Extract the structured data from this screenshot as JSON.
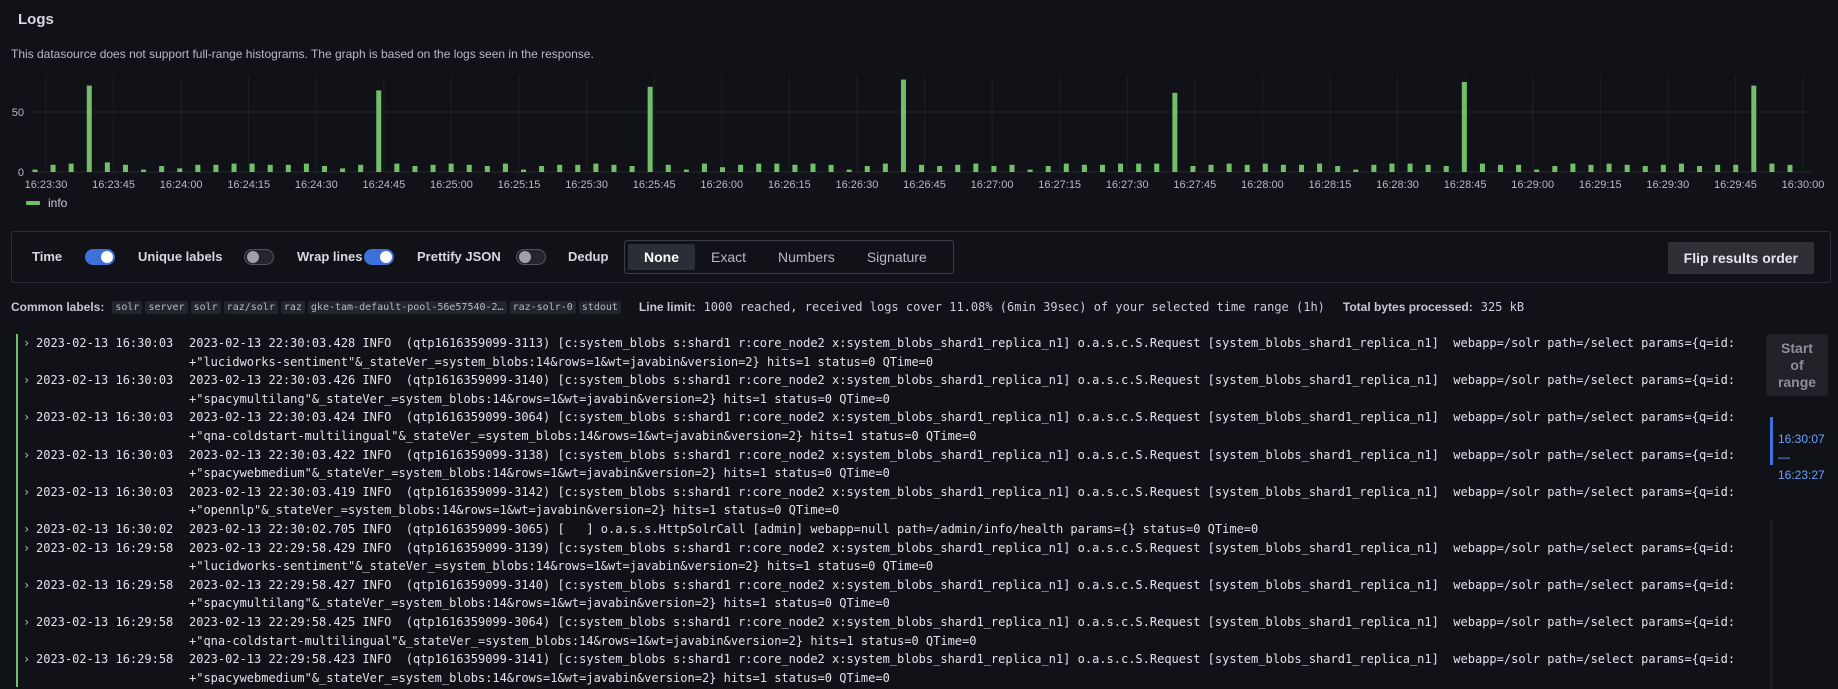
{
  "panel": {
    "title": "Logs",
    "notice": "This datasource does not support full-range histograms. The graph is based on the logs seen in the response."
  },
  "chart_data": {
    "type": "bar",
    "y_ticks": [
      0,
      50
    ],
    "ylim": [
      0,
      80
    ],
    "x_tick_labels": [
      "16:23:30",
      "16:23:45",
      "16:24:00",
      "16:24:15",
      "16:24:30",
      "16:24:45",
      "16:25:00",
      "16:25:15",
      "16:25:30",
      "16:25:45",
      "16:26:00",
      "16:26:15",
      "16:26:30",
      "16:26:45",
      "16:27:00",
      "16:27:15",
      "16:27:30",
      "16:27:45",
      "16:28:00",
      "16:28:15",
      "16:28:30",
      "16:28:45",
      "16:29:00",
      "16:29:15",
      "16:29:30",
      "16:29:45",
      "16:30:00"
    ],
    "grid": true,
    "series": [
      {
        "name": "info",
        "color": "#73bf69",
        "values": [
          2,
          6,
          7,
          72,
          8,
          6,
          2,
          5,
          3,
          6,
          6,
          7,
          7,
          6,
          6,
          7,
          5,
          3,
          6,
          68,
          7,
          5,
          6,
          7,
          6,
          5,
          7,
          2,
          5,
          6,
          6,
          7,
          6,
          5,
          71,
          6,
          2,
          7,
          4,
          6,
          7,
          7,
          6,
          7,
          6,
          2,
          5,
          7,
          77,
          6,
          5,
          6,
          7,
          5,
          6,
          2,
          5,
          7,
          6,
          6,
          7,
          7,
          7,
          66,
          5,
          6,
          7,
          6,
          7,
          6,
          6,
          7,
          5,
          2,
          6,
          7,
          7,
          6,
          5,
          75,
          7,
          6,
          6,
          2,
          5,
          7,
          6,
          7,
          6,
          5,
          6,
          7,
          5,
          6,
          6,
          72,
          7,
          6
        ]
      }
    ],
    "legend": "bottom-left"
  },
  "options": {
    "time": {
      "label": "Time",
      "on": true
    },
    "unique_labels": {
      "label": "Unique labels",
      "on": false
    },
    "wrap_lines": {
      "label": "Wrap lines",
      "on": true
    },
    "prettify_json": {
      "label": "Prettify JSON",
      "on": false
    },
    "dedup": {
      "label": "Dedup",
      "options": [
        "None",
        "Exact",
        "Numbers",
        "Signature"
      ],
      "selected": "None"
    },
    "flip_label": "Flip results order"
  },
  "meta": {
    "common_labels_label": "Common labels:",
    "common_labels": [
      "solr",
      "server",
      "solr",
      "raz/solr",
      "raz",
      "gke-tam-default-pool-56e57540-2…",
      "raz-solr-0",
      "stdout"
    ],
    "line_limit_label": "Line limit:",
    "line_limit_value": "1000 reached, received logs cover 11.08% (6min 39sec) of your selected time range (1h)",
    "bytes_label": "Total bytes processed:",
    "bytes_value": "325 kB"
  },
  "logs": [
    {
      "ts": "2023-02-13 16:30:03",
      "msg": "2023-02-13 22:30:03.428 INFO  (qtp1616359099-3113) [c:system_blobs s:shard1 r:core_node2 x:system_blobs_shard1_replica_n1] o.a.s.c.S.Request [system_blobs_shard1_replica_n1]  webapp=/solr path=/select params={q=id:\n+\"lucidworks-sentiment\"&_stateVer_=system_blobs:14&rows=1&wt=javabin&version=2} hits=1 status=0 QTime=0"
    },
    {
      "ts": "2023-02-13 16:30:03",
      "msg": "2023-02-13 22:30:03.426 INFO  (qtp1616359099-3140) [c:system_blobs s:shard1 r:core_node2 x:system_blobs_shard1_replica_n1] o.a.s.c.S.Request [system_blobs_shard1_replica_n1]  webapp=/solr path=/select params={q=id:\n+\"spacymultilang\"&_stateVer_=system_blobs:14&rows=1&wt=javabin&version=2} hits=1 status=0 QTime=0"
    },
    {
      "ts": "2023-02-13 16:30:03",
      "msg": "2023-02-13 22:30:03.424 INFO  (qtp1616359099-3064) [c:system_blobs s:shard1 r:core_node2 x:system_blobs_shard1_replica_n1] o.a.s.c.S.Request [system_blobs_shard1_replica_n1]  webapp=/solr path=/select params={q=id:\n+\"qna-coldstart-multilingual\"&_stateVer_=system_blobs:14&rows=1&wt=javabin&version=2} hits=1 status=0 QTime=0"
    },
    {
      "ts": "2023-02-13 16:30:03",
      "msg": "2023-02-13 22:30:03.422 INFO  (qtp1616359099-3138) [c:system_blobs s:shard1 r:core_node2 x:system_blobs_shard1_replica_n1] o.a.s.c.S.Request [system_blobs_shard1_replica_n1]  webapp=/solr path=/select params={q=id:\n+\"spacywebmedium\"&_stateVer_=system_blobs:14&rows=1&wt=javabin&version=2} hits=1 status=0 QTime=0"
    },
    {
      "ts": "2023-02-13 16:30:03",
      "msg": "2023-02-13 22:30:03.419 INFO  (qtp1616359099-3142) [c:system_blobs s:shard1 r:core_node2 x:system_blobs_shard1_replica_n1] o.a.s.c.S.Request [system_blobs_shard1_replica_n1]  webapp=/solr path=/select params={q=id:\n+\"opennlp\"&_stateVer_=system_blobs:14&rows=1&wt=javabin&version=2} hits=1 status=0 QTime=0"
    },
    {
      "ts": "2023-02-13 16:30:02",
      "msg": "2023-02-13 22:30:02.705 INFO  (qtp1616359099-3065) [   ] o.a.s.s.HttpSolrCall [admin] webapp=null path=/admin/info/health params={} status=0 QTime=0"
    },
    {
      "ts": "2023-02-13 16:29:58",
      "msg": "2023-02-13 22:29:58.429 INFO  (qtp1616359099-3139) [c:system_blobs s:shard1 r:core_node2 x:system_blobs_shard1_replica_n1] o.a.s.c.S.Request [system_blobs_shard1_replica_n1]  webapp=/solr path=/select params={q=id:\n+\"lucidworks-sentiment\"&_stateVer_=system_blobs:14&rows=1&wt=javabin&version=2} hits=1 status=0 QTime=0"
    },
    {
      "ts": "2023-02-13 16:29:58",
      "msg": "2023-02-13 22:29:58.427 INFO  (qtp1616359099-3140) [c:system_blobs s:shard1 r:core_node2 x:system_blobs_shard1_replica_n1] o.a.s.c.S.Request [system_blobs_shard1_replica_n1]  webapp=/solr path=/select params={q=id:\n+\"spacymultilang\"&_stateVer_=system_blobs:14&rows=1&wt=javabin&version=2} hits=1 status=0 QTime=0"
    },
    {
      "ts": "2023-02-13 16:29:58",
      "msg": "2023-02-13 22:29:58.425 INFO  (qtp1616359099-3064) [c:system_blobs s:shard1 r:core_node2 x:system_blobs_shard1_replica_n1] o.a.s.c.S.Request [system_blobs_shard1_replica_n1]  webapp=/solr path=/select params={q=id:\n+\"qna-coldstart-multilingual\"&_stateVer_=system_blobs:14&rows=1&wt=javabin&version=2} hits=1 status=0 QTime=0"
    },
    {
      "ts": "2023-02-13 16:29:58",
      "msg": "2023-02-13 22:29:58.423 INFO  (qtp1616359099-3141) [c:system_blobs s:shard1 r:core_node2 x:system_blobs_shard1_replica_n1] o.a.s.c.S.Request [system_blobs_shard1_replica_n1]  webapp=/solr path=/select params={q=id:\n+\"spacywebmedium\"&_stateVer_=system_blobs:14&rows=1&wt=javabin&version=2} hits=1 status=0 QTime=0"
    }
  ],
  "range": {
    "start_label": "Start of range",
    "from": "16:30:07",
    "sep": "—",
    "to": "16:23:27",
    "indicator_color": "#3d71d9"
  }
}
